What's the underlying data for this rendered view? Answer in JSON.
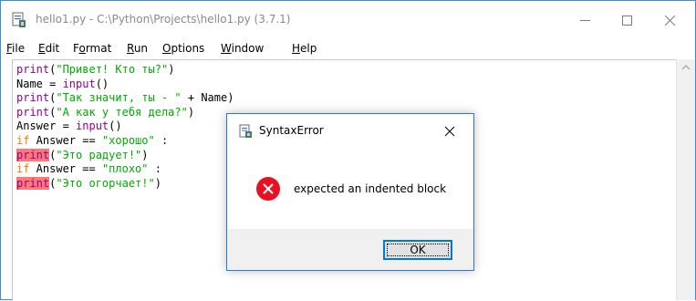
{
  "window": {
    "title": "hello1.py - C:\\Python\\Projects\\hello1.py (3.7.1)",
    "icon": "idle-file-icon",
    "controls": {
      "minimize": "minimize-icon",
      "maximize": "maximize-icon",
      "close": "close-icon"
    }
  },
  "menu": {
    "items": [
      {
        "label": "File",
        "mnemonic": "F",
        "rest": "ile"
      },
      {
        "label": "Edit",
        "mnemonic": "E",
        "rest": "dit"
      },
      {
        "label": "Format",
        "mnemonic": "o",
        "pre": "F",
        "rest": "rmat"
      },
      {
        "label": "Run",
        "mnemonic": "R",
        "rest": "un"
      },
      {
        "label": "Options",
        "mnemonic": "O",
        "rest": "ptions"
      },
      {
        "label": "Window",
        "mnemonic": "W",
        "rest": "indow"
      },
      {
        "label": "Help",
        "mnemonic": "H",
        "rest": "elp"
      }
    ]
  },
  "editor": {
    "lines": [
      [
        {
          "t": "print",
          "c": "kw-builtin"
        },
        {
          "t": "(",
          "c": ""
        },
        {
          "t": "\"Привет! Кто ты?\"",
          "c": "str"
        },
        {
          "t": ")",
          "c": ""
        }
      ],
      [
        {
          "t": "Name = ",
          "c": ""
        },
        {
          "t": "input",
          "c": "kw-builtin"
        },
        {
          "t": "()",
          "c": ""
        }
      ],
      [
        {
          "t": "print",
          "c": "kw-builtin"
        },
        {
          "t": "(",
          "c": ""
        },
        {
          "t": "\"Так значит, ты - \"",
          "c": "str"
        },
        {
          "t": " + Name)",
          "c": ""
        }
      ],
      [
        {
          "t": "print",
          "c": "kw-builtin"
        },
        {
          "t": "(",
          "c": ""
        },
        {
          "t": "\"А как у тебя дела?\"",
          "c": "str"
        },
        {
          "t": ")",
          "c": ""
        }
      ],
      [
        {
          "t": "Answer = ",
          "c": ""
        },
        {
          "t": "input",
          "c": "kw-builtin"
        },
        {
          "t": "()",
          "c": ""
        }
      ],
      [
        {
          "t": "if",
          "c": "kw"
        },
        {
          "t": " Answer == ",
          "c": ""
        },
        {
          "t": "\"хорошо\"",
          "c": "str"
        },
        {
          "t": " :",
          "c": ""
        }
      ],
      [
        {
          "t": "print",
          "c": "err"
        },
        {
          "t": "(",
          "c": ""
        },
        {
          "t": "\"Это радует!\"",
          "c": "str"
        },
        {
          "t": ")",
          "c": ""
        }
      ],
      [
        {
          "t": "if",
          "c": "kw"
        },
        {
          "t": " Answer == ",
          "c": ""
        },
        {
          "t": "\"плохо\"",
          "c": "str"
        },
        {
          "t": " :",
          "c": ""
        }
      ],
      [
        {
          "t": "print",
          "c": "err"
        },
        {
          "t": "(",
          "c": ""
        },
        {
          "t": "\"Это огорчает!\"",
          "c": "str"
        },
        {
          "t": ")",
          "c": ""
        }
      ]
    ]
  },
  "scrollbar": {
    "up_arrow": "scroll-up-arrow-icon"
  },
  "dialog": {
    "title": "SyntaxError",
    "message": "expected an indented block",
    "ok_label": "OK",
    "icon": "error-x-icon",
    "close": "close-icon"
  },
  "colors": {
    "builtin": "#900090",
    "keyword": "#ff7700",
    "string": "#00aa00",
    "error_highlight": "#ff7777",
    "error_icon": "#e81123",
    "dialog_border": "#2b79d0"
  }
}
